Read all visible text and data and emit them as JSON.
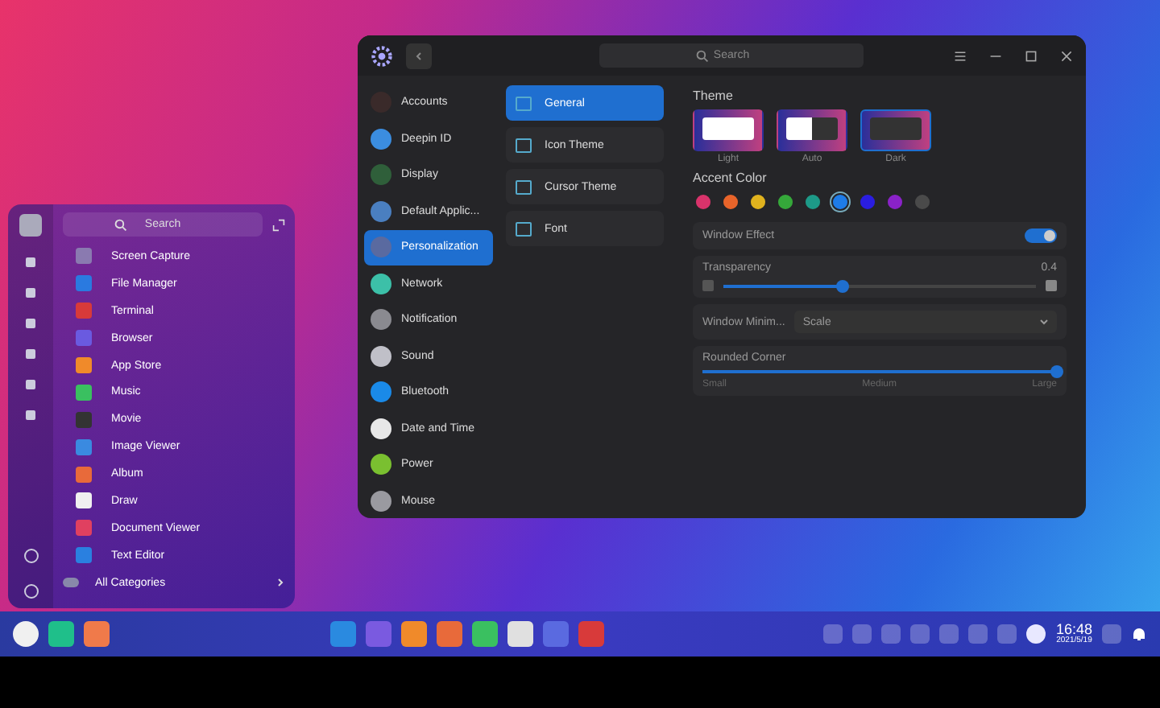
{
  "settings_window": {
    "search": {
      "placeholder": "Search"
    },
    "nav_items": [
      {
        "label": "Accounts",
        "selected": false
      },
      {
        "label": "Deepin ID",
        "selected": false
      },
      {
        "label": "Display",
        "selected": false
      },
      {
        "label": "Default Applic...",
        "selected": false
      },
      {
        "label": "Personalization",
        "selected": true
      },
      {
        "label": "Network",
        "selected": false
      },
      {
        "label": "Notification",
        "selected": false
      },
      {
        "label": "Sound",
        "selected": false
      },
      {
        "label": "Bluetooth",
        "selected": false
      },
      {
        "label": "Date and Time",
        "selected": false
      },
      {
        "label": "Power",
        "selected": false
      },
      {
        "label": "Mouse",
        "selected": false
      }
    ],
    "sub_items": [
      {
        "label": "General",
        "selected": true
      },
      {
        "label": "Icon Theme",
        "selected": false
      },
      {
        "label": "Cursor Theme",
        "selected": false
      },
      {
        "label": "Font",
        "selected": false
      }
    ],
    "theme": {
      "title": "Theme",
      "options": [
        {
          "label": "Light",
          "selected": false
        },
        {
          "label": "Auto",
          "selected": false
        },
        {
          "label": "Dark",
          "selected": true
        }
      ]
    },
    "accent_color": {
      "title": "Accent Color",
      "colors": [
        {
          "color": "#d9336b",
          "selected": false
        },
        {
          "color": "#e8642a",
          "selected": false
        },
        {
          "color": "#e0b21e",
          "selected": false
        },
        {
          "color": "#35a83a",
          "selected": false
        },
        {
          "color": "#1d9a88",
          "selected": false
        },
        {
          "color": "#1e7ce8",
          "selected": true
        },
        {
          "color": "#2a1de0",
          "selected": false
        },
        {
          "color": "#8a22c8",
          "selected": false
        },
        {
          "color": "#4a4a4a",
          "selected": false
        }
      ]
    },
    "window_effect": {
      "label": "Window Effect",
      "on": true
    },
    "transparency": {
      "label": "Transparency",
      "reading": "0.4",
      "level": 0.38
    },
    "window_minimize": {
      "label": "Window Minim...",
      "value": "Scale"
    },
    "rounded_corner": {
      "label": "Rounded Corner",
      "level": 1.0,
      "ticks": [
        "Small",
        "Medium",
        "Large"
      ]
    }
  },
  "launcher": {
    "search": {
      "placeholder": "Search"
    },
    "apps": [
      "Screen Capture",
      "File Manager",
      "Terminal",
      "Browser",
      "App Store",
      "Music",
      "Movie",
      "Image Viewer",
      "Album",
      "Draw",
      "Document Viewer",
      "Text Editor"
    ],
    "all_categories": "All Categories"
  },
  "taskbar": {
    "time": "16:48",
    "date": "2021/5/19"
  }
}
